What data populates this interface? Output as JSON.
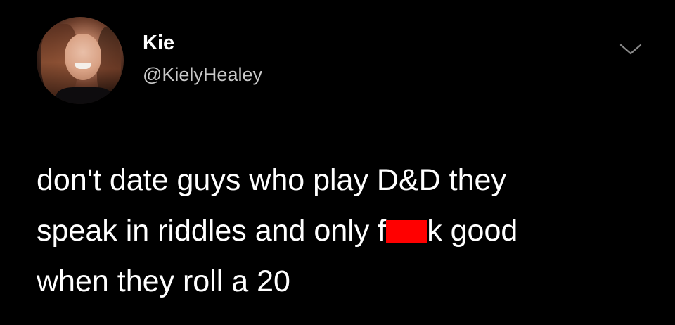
{
  "author": {
    "display_name": "Kie",
    "handle": "@KielyHealey",
    "avatar_icon": "profile-photo"
  },
  "menu": {
    "icon": "chevron-down-icon"
  },
  "tweet": {
    "line1": "don't date guys who play D&D they",
    "line2_before": "speak in riddles and only f",
    "line2_after": "k good",
    "line3": "when they roll a 20"
  },
  "colors": {
    "background": "#000000",
    "text": "#ffffff",
    "secondary_text": "#c9c9c9",
    "censor_bar": "#ff0000"
  }
}
